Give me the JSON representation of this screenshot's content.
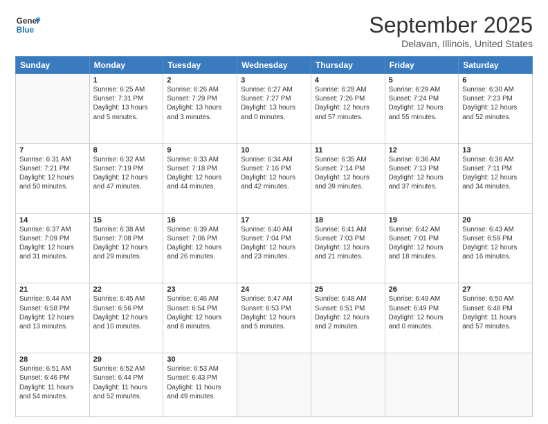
{
  "logo": {
    "line1": "General",
    "line2": "Blue"
  },
  "title": "September 2025",
  "subtitle": "Delavan, Illinois, United States",
  "weekdays": [
    "Sunday",
    "Monday",
    "Tuesday",
    "Wednesday",
    "Thursday",
    "Friday",
    "Saturday"
  ],
  "weeks": [
    [
      {
        "day": "",
        "content": ""
      },
      {
        "day": "1",
        "content": "Sunrise: 6:25 AM\nSunset: 7:31 PM\nDaylight: 13 hours\nand 5 minutes."
      },
      {
        "day": "2",
        "content": "Sunrise: 6:26 AM\nSunset: 7:29 PM\nDaylight: 13 hours\nand 3 minutes."
      },
      {
        "day": "3",
        "content": "Sunrise: 6:27 AM\nSunset: 7:27 PM\nDaylight: 13 hours\nand 0 minutes."
      },
      {
        "day": "4",
        "content": "Sunrise: 6:28 AM\nSunset: 7:26 PM\nDaylight: 12 hours\nand 57 minutes."
      },
      {
        "day": "5",
        "content": "Sunrise: 6:29 AM\nSunset: 7:24 PM\nDaylight: 12 hours\nand 55 minutes."
      },
      {
        "day": "6",
        "content": "Sunrise: 6:30 AM\nSunset: 7:23 PM\nDaylight: 12 hours\nand 52 minutes."
      }
    ],
    [
      {
        "day": "7",
        "content": "Sunrise: 6:31 AM\nSunset: 7:21 PM\nDaylight: 12 hours\nand 50 minutes."
      },
      {
        "day": "8",
        "content": "Sunrise: 6:32 AM\nSunset: 7:19 PM\nDaylight: 12 hours\nand 47 minutes."
      },
      {
        "day": "9",
        "content": "Sunrise: 6:33 AM\nSunset: 7:18 PM\nDaylight: 12 hours\nand 44 minutes."
      },
      {
        "day": "10",
        "content": "Sunrise: 6:34 AM\nSunset: 7:16 PM\nDaylight: 12 hours\nand 42 minutes."
      },
      {
        "day": "11",
        "content": "Sunrise: 6:35 AM\nSunset: 7:14 PM\nDaylight: 12 hours\nand 39 minutes."
      },
      {
        "day": "12",
        "content": "Sunrise: 6:36 AM\nSunset: 7:13 PM\nDaylight: 12 hours\nand 37 minutes."
      },
      {
        "day": "13",
        "content": "Sunrise: 6:36 AM\nSunset: 7:11 PM\nDaylight: 12 hours\nand 34 minutes."
      }
    ],
    [
      {
        "day": "14",
        "content": "Sunrise: 6:37 AM\nSunset: 7:09 PM\nDaylight: 12 hours\nand 31 minutes."
      },
      {
        "day": "15",
        "content": "Sunrise: 6:38 AM\nSunset: 7:08 PM\nDaylight: 12 hours\nand 29 minutes."
      },
      {
        "day": "16",
        "content": "Sunrise: 6:39 AM\nSunset: 7:06 PM\nDaylight: 12 hours\nand 26 minutes."
      },
      {
        "day": "17",
        "content": "Sunrise: 6:40 AM\nSunset: 7:04 PM\nDaylight: 12 hours\nand 23 minutes."
      },
      {
        "day": "18",
        "content": "Sunrise: 6:41 AM\nSunset: 7:03 PM\nDaylight: 12 hours\nand 21 minutes."
      },
      {
        "day": "19",
        "content": "Sunrise: 6:42 AM\nSunset: 7:01 PM\nDaylight: 12 hours\nand 18 minutes."
      },
      {
        "day": "20",
        "content": "Sunrise: 6:43 AM\nSunset: 6:59 PM\nDaylight: 12 hours\nand 16 minutes."
      }
    ],
    [
      {
        "day": "21",
        "content": "Sunrise: 6:44 AM\nSunset: 6:58 PM\nDaylight: 12 hours\nand 13 minutes."
      },
      {
        "day": "22",
        "content": "Sunrise: 6:45 AM\nSunset: 6:56 PM\nDaylight: 12 hours\nand 10 minutes."
      },
      {
        "day": "23",
        "content": "Sunrise: 6:46 AM\nSunset: 6:54 PM\nDaylight: 12 hours\nand 8 minutes."
      },
      {
        "day": "24",
        "content": "Sunrise: 6:47 AM\nSunset: 6:53 PM\nDaylight: 12 hours\nand 5 minutes."
      },
      {
        "day": "25",
        "content": "Sunrise: 6:48 AM\nSunset: 6:51 PM\nDaylight: 12 hours\nand 2 minutes."
      },
      {
        "day": "26",
        "content": "Sunrise: 6:49 AM\nSunset: 6:49 PM\nDaylight: 12 hours\nand 0 minutes."
      },
      {
        "day": "27",
        "content": "Sunrise: 6:50 AM\nSunset: 6:48 PM\nDaylight: 11 hours\nand 57 minutes."
      }
    ],
    [
      {
        "day": "28",
        "content": "Sunrise: 6:51 AM\nSunset: 6:46 PM\nDaylight: 11 hours\nand 54 minutes."
      },
      {
        "day": "29",
        "content": "Sunrise: 6:52 AM\nSunset: 6:44 PM\nDaylight: 11 hours\nand 52 minutes."
      },
      {
        "day": "30",
        "content": "Sunrise: 6:53 AM\nSunset: 6:43 PM\nDaylight: 11 hours\nand 49 minutes."
      },
      {
        "day": "",
        "content": ""
      },
      {
        "day": "",
        "content": ""
      },
      {
        "day": "",
        "content": ""
      },
      {
        "day": "",
        "content": ""
      }
    ]
  ]
}
